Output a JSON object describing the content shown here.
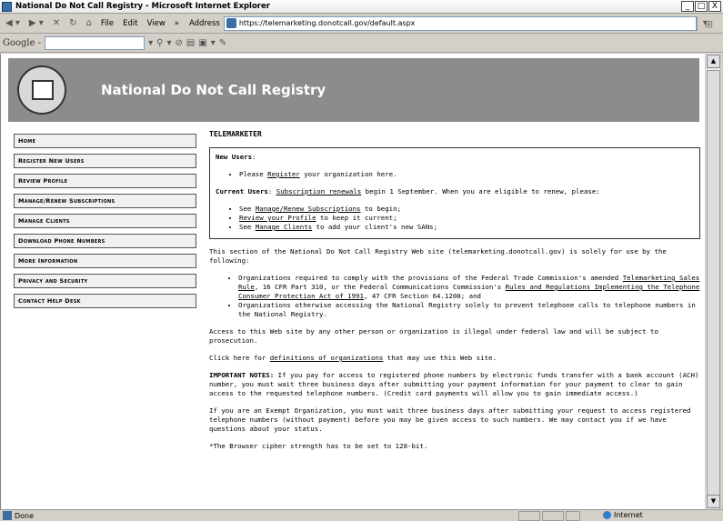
{
  "window": {
    "title": "National Do Not Call Registry - Microsoft Internet Explorer",
    "buttons": [
      "_",
      "□",
      "X"
    ]
  },
  "menu": {
    "file": "File",
    "edit": "Edit",
    "view": "View",
    "more": "»",
    "address_label": "Address"
  },
  "address": {
    "url": "https://telemarketing.donotcall.gov/default.aspx"
  },
  "google": {
    "label": "Google -"
  },
  "banner": {
    "title": "National Do Not Call Registry"
  },
  "sidebar": {
    "items": [
      {
        "label": "Home"
      },
      {
        "label": "Register New Users"
      },
      {
        "label": "Review Profile"
      },
      {
        "label": "Manage/Renew Subscriptions"
      },
      {
        "label": "Manage Clients"
      },
      {
        "label": "Download Phone Numbers"
      },
      {
        "label": "More Information"
      },
      {
        "label": "Privacy and Security"
      },
      {
        "label": "Contact Help Desk"
      }
    ]
  },
  "content": {
    "heading": "TELEMARKETER",
    "new_users_label": "New Users",
    "new_users_colon": ":",
    "new_users_pre": "Please ",
    "new_users_link": "Register",
    "new_users_post": " your organization here.",
    "current_users_label": "Current Users",
    "current_users_colon": ": ",
    "current_users_link": "Subscription renewals",
    "current_users_post": " begin 1 September. When you are eligible to renew, please:",
    "bullet1_pre": "See ",
    "bullet1_link": "Manage/Renew Subscriptions",
    "bullet1_post": " to begin;",
    "bullet2_link": "Review your Profile",
    "bullet2_post": " to keep it current;",
    "bullet3_pre": "See ",
    "bullet3_link": "Manage Clients",
    "bullet3_post": " to add your client's new SANs;",
    "intro": "This section of the National Do Not Call Registry Web site (telemarketing.donotcall.gov) is solely for use by the following:",
    "org1_pre": "Organizations required to comply with the provisions of the Federal Trade Commission's amended ",
    "org1_link1": "Telemarketing Sales Rule",
    "org1_mid": ", 16 CFR Part 310, or the Federal Communications Commission's ",
    "org1_link2": "Rules and Regulations Implementing the Telephone Consumer Protection Act of 1991",
    "org1_post": ", 47 CFR Section 64.1200; and",
    "org2": "Organizations otherwise accessing the National Registry solely to prevent telephone calls to telephone numbers in the National Registry.",
    "access": "Access to this Web site by any other person or organization is illegal under federal law and will be subject to prosecution.",
    "click_pre": "Click here for ",
    "click_link": "definitions of organizations",
    "click_post": " that may use this Web site.",
    "important_label": "IMPORTANT NOTES:",
    "important_text": " If you pay for access to registered phone numbers by electronic funds transfer with a bank account (ACH) number, you must wait three business days after submitting your payment information for your payment to clear to gain access to the requested telephone numbers. (Credit card payments will allow you to gain immediate access.)",
    "exempt": "If you are an Exempt Organization, you must wait three business days after submitting your request to access registered telephone numbers (without payment) before you may be given access to such numbers. We may contact you if we have questions about your status.",
    "cipher": "*The Browser cipher strength has to be set to 128-bit."
  },
  "status": {
    "text": "Done",
    "zone": "Internet"
  }
}
